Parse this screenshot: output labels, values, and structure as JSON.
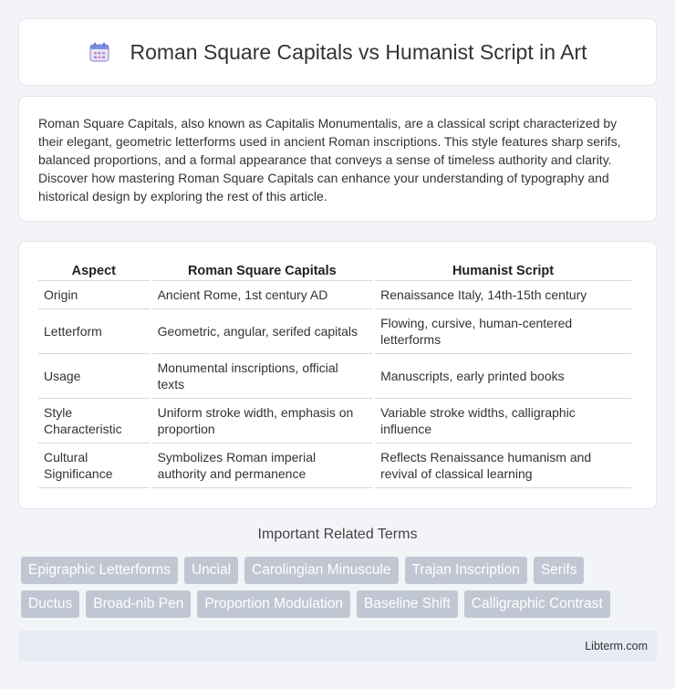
{
  "header": {
    "title": "Roman Square Capitals vs Humanist Script in Art",
    "icon": "calendar-icon"
  },
  "intro": {
    "text": "Roman Square Capitals, also known as Capitalis Monumentalis, are a classical script characterized by their elegant, geometric letterforms used in ancient Roman inscriptions. This style features sharp serifs, balanced proportions, and a formal appearance that conveys a sense of timeless authority and clarity. Discover how mastering Roman Square Capitals can enhance your understanding of typography and historical design by exploring the rest of this article."
  },
  "table": {
    "headers": [
      "Aspect",
      "Roman Square Capitals",
      "Humanist Script"
    ],
    "rows": [
      [
        "Origin",
        "Ancient Rome, 1st century AD",
        "Renaissance Italy, 14th-15th century"
      ],
      [
        "Letterform",
        "Geometric, angular, serifed capitals",
        "Flowing, cursive, human-centered letterforms"
      ],
      [
        "Usage",
        "Monumental inscriptions, official texts",
        "Manuscripts, early printed books"
      ],
      [
        "Style Characteristic",
        "Uniform stroke width, emphasis on proportion",
        "Variable stroke widths, calligraphic influence"
      ],
      [
        "Cultural Significance",
        "Symbolizes Roman imperial authority and permanence",
        "Reflects Renaissance humanism and revival of classical learning"
      ]
    ]
  },
  "related": {
    "title": "Important Related Terms",
    "row1": [
      "Epigraphic Letterforms",
      "Uncial",
      "Carolingian Minuscule",
      "Trajan Inscription",
      "Serifs"
    ],
    "row2": [
      "Ductus",
      "Broad-nib Pen",
      "Proportion Modulation",
      "Baseline Shift",
      "Calligraphic Contrast"
    ]
  },
  "footer": {
    "text": "Libterm.com"
  },
  "colors": {
    "tag_bg": "#c1c7d2",
    "footer_bg": "#e6ebf4",
    "page_bg": "#f2f4f8"
  }
}
